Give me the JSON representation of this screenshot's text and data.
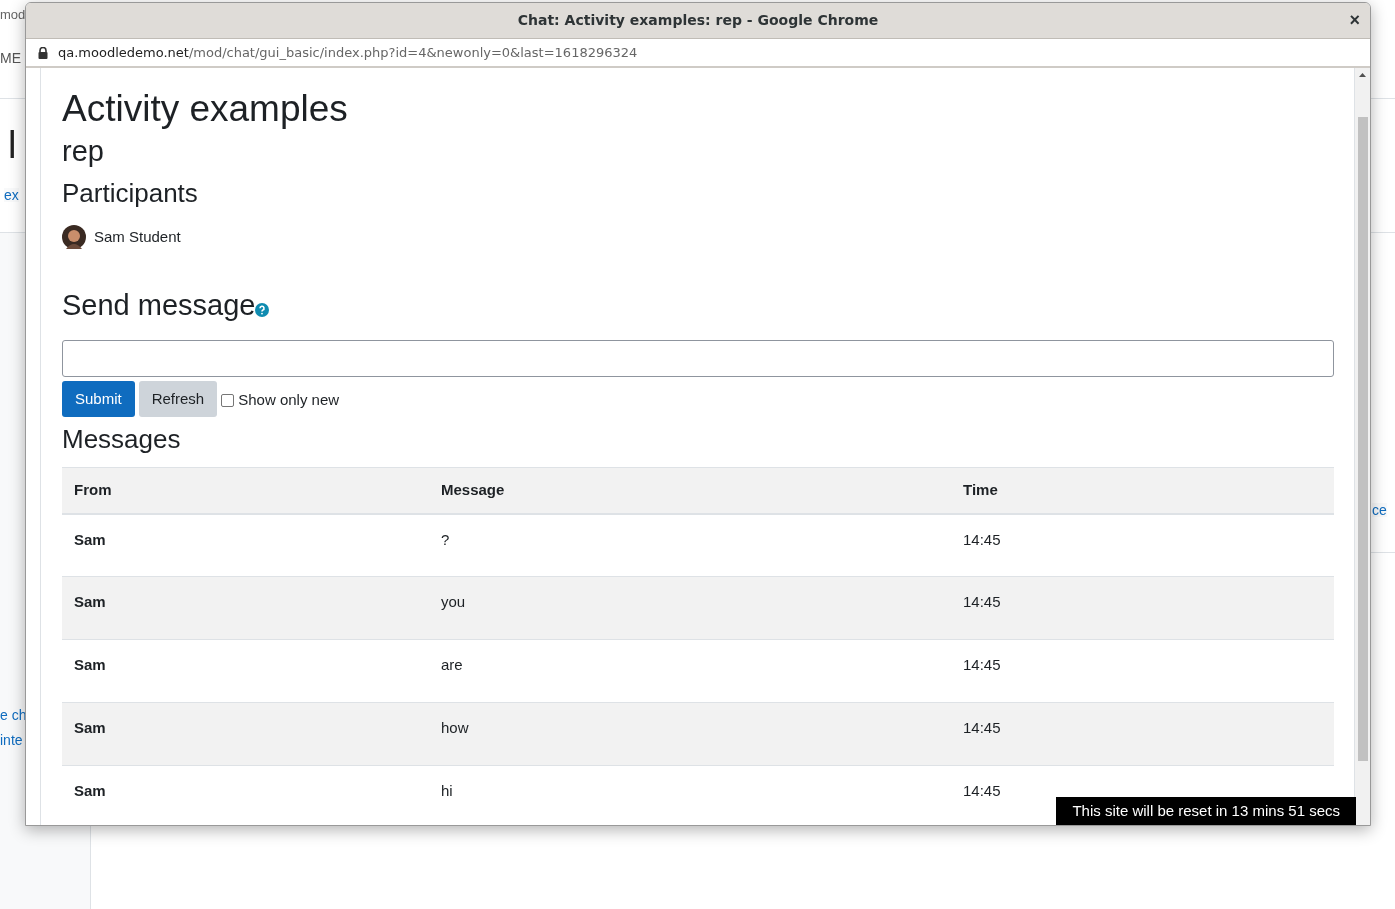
{
  "background_page": {
    "fragments": [
      {
        "kind": "small",
        "text": "mod"
      },
      {
        "kind": "nav",
        "text": "ME"
      },
      {
        "kind": "heading",
        "text": "l"
      },
      {
        "kind": "link",
        "text": "ex"
      },
      {
        "kind": "link",
        "text": "e ch"
      },
      {
        "kind": "link",
        "text": "inte"
      },
      {
        "kind": "link",
        "text": "ce"
      }
    ]
  },
  "window": {
    "title": "Chat: Activity examples: rep - Google Chrome",
    "close": "×",
    "url_host": "qa.moodledemo.net",
    "url_path": "/mod/chat/gui_basic/index.php?id=4&newonly=0&last=1618296324"
  },
  "page": {
    "title": "Activity examples",
    "subtitle": "rep",
    "participants_heading": "Participants",
    "participants": [
      {
        "name": "Sam Student"
      }
    ],
    "send_heading": "Send message",
    "buttons": [
      {
        "label": "Submit",
        "kind": "primary"
      },
      {
        "label": "Refresh",
        "kind": "secondary"
      }
    ],
    "show_only_new": {
      "label": "Show only new",
      "checked": false
    },
    "messages_heading": "Messages",
    "table": {
      "columns": [
        "From",
        "Message",
        "Time"
      ],
      "rows": [
        {
          "from": "Sam",
          "message": "?",
          "time": "14:45"
        },
        {
          "from": "Sam",
          "message": "you",
          "time": "14:45"
        },
        {
          "from": "Sam",
          "message": "are",
          "time": "14:45"
        },
        {
          "from": "Sam",
          "message": "how",
          "time": "14:45"
        },
        {
          "from": "Sam",
          "message": "hi",
          "time": "14:45"
        }
      ]
    }
  },
  "reset_notice": "This site will be reset in 13 mins 51 secs"
}
